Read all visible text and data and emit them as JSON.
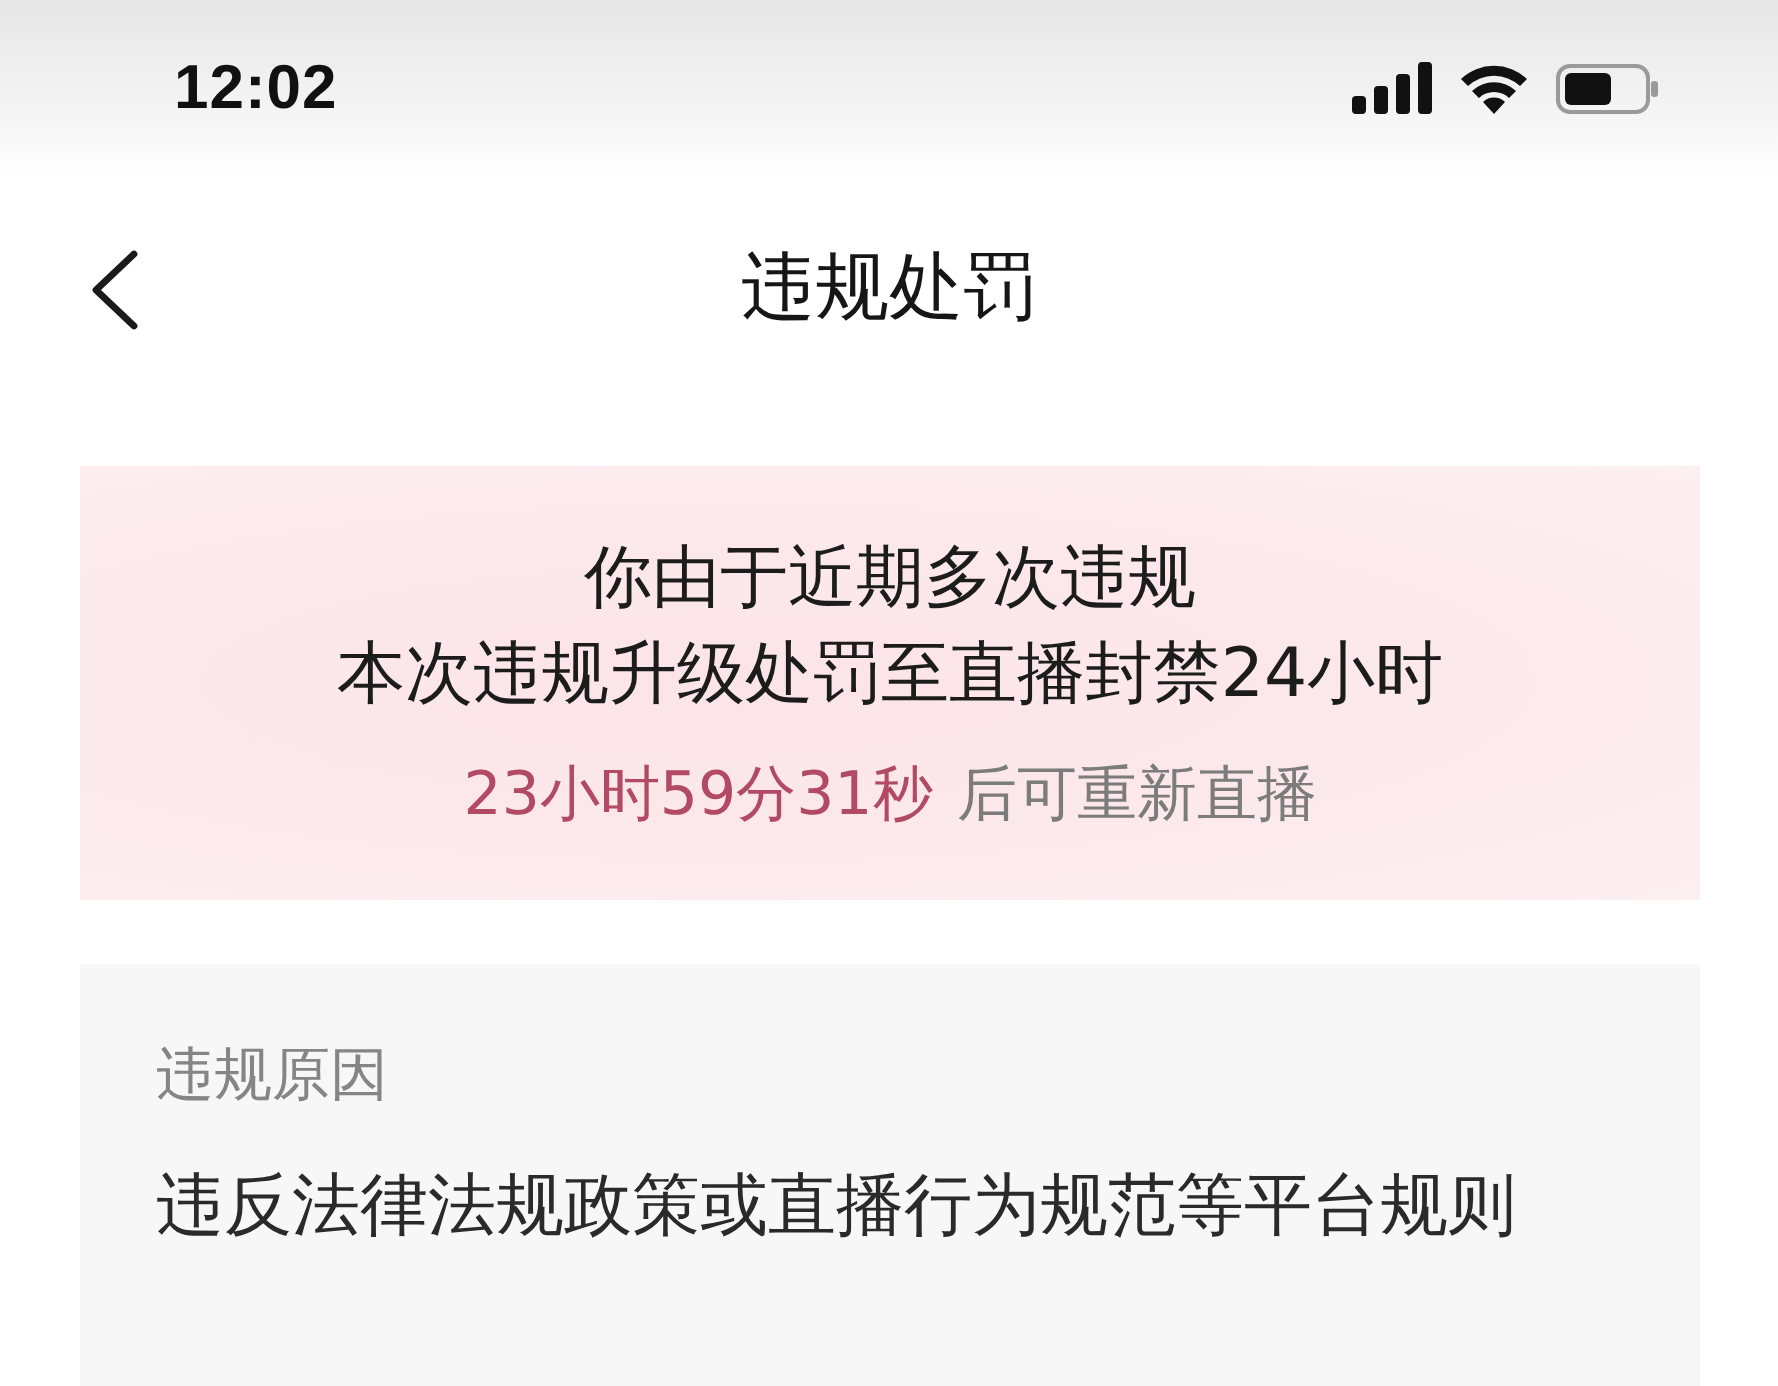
{
  "status_bar": {
    "time": "12:02"
  },
  "nav": {
    "title": "违规处罚"
  },
  "notice": {
    "lines": [
      "你由于近期多次违规",
      "本次违规升级处罚至直播封禁24小时"
    ],
    "countdown": "23小时59分31秒",
    "countdown_suffix": "后可重新直播"
  },
  "reason": {
    "label": "违规原因",
    "value": "违反法律法规政策或直播行为规范等平台规则"
  }
}
